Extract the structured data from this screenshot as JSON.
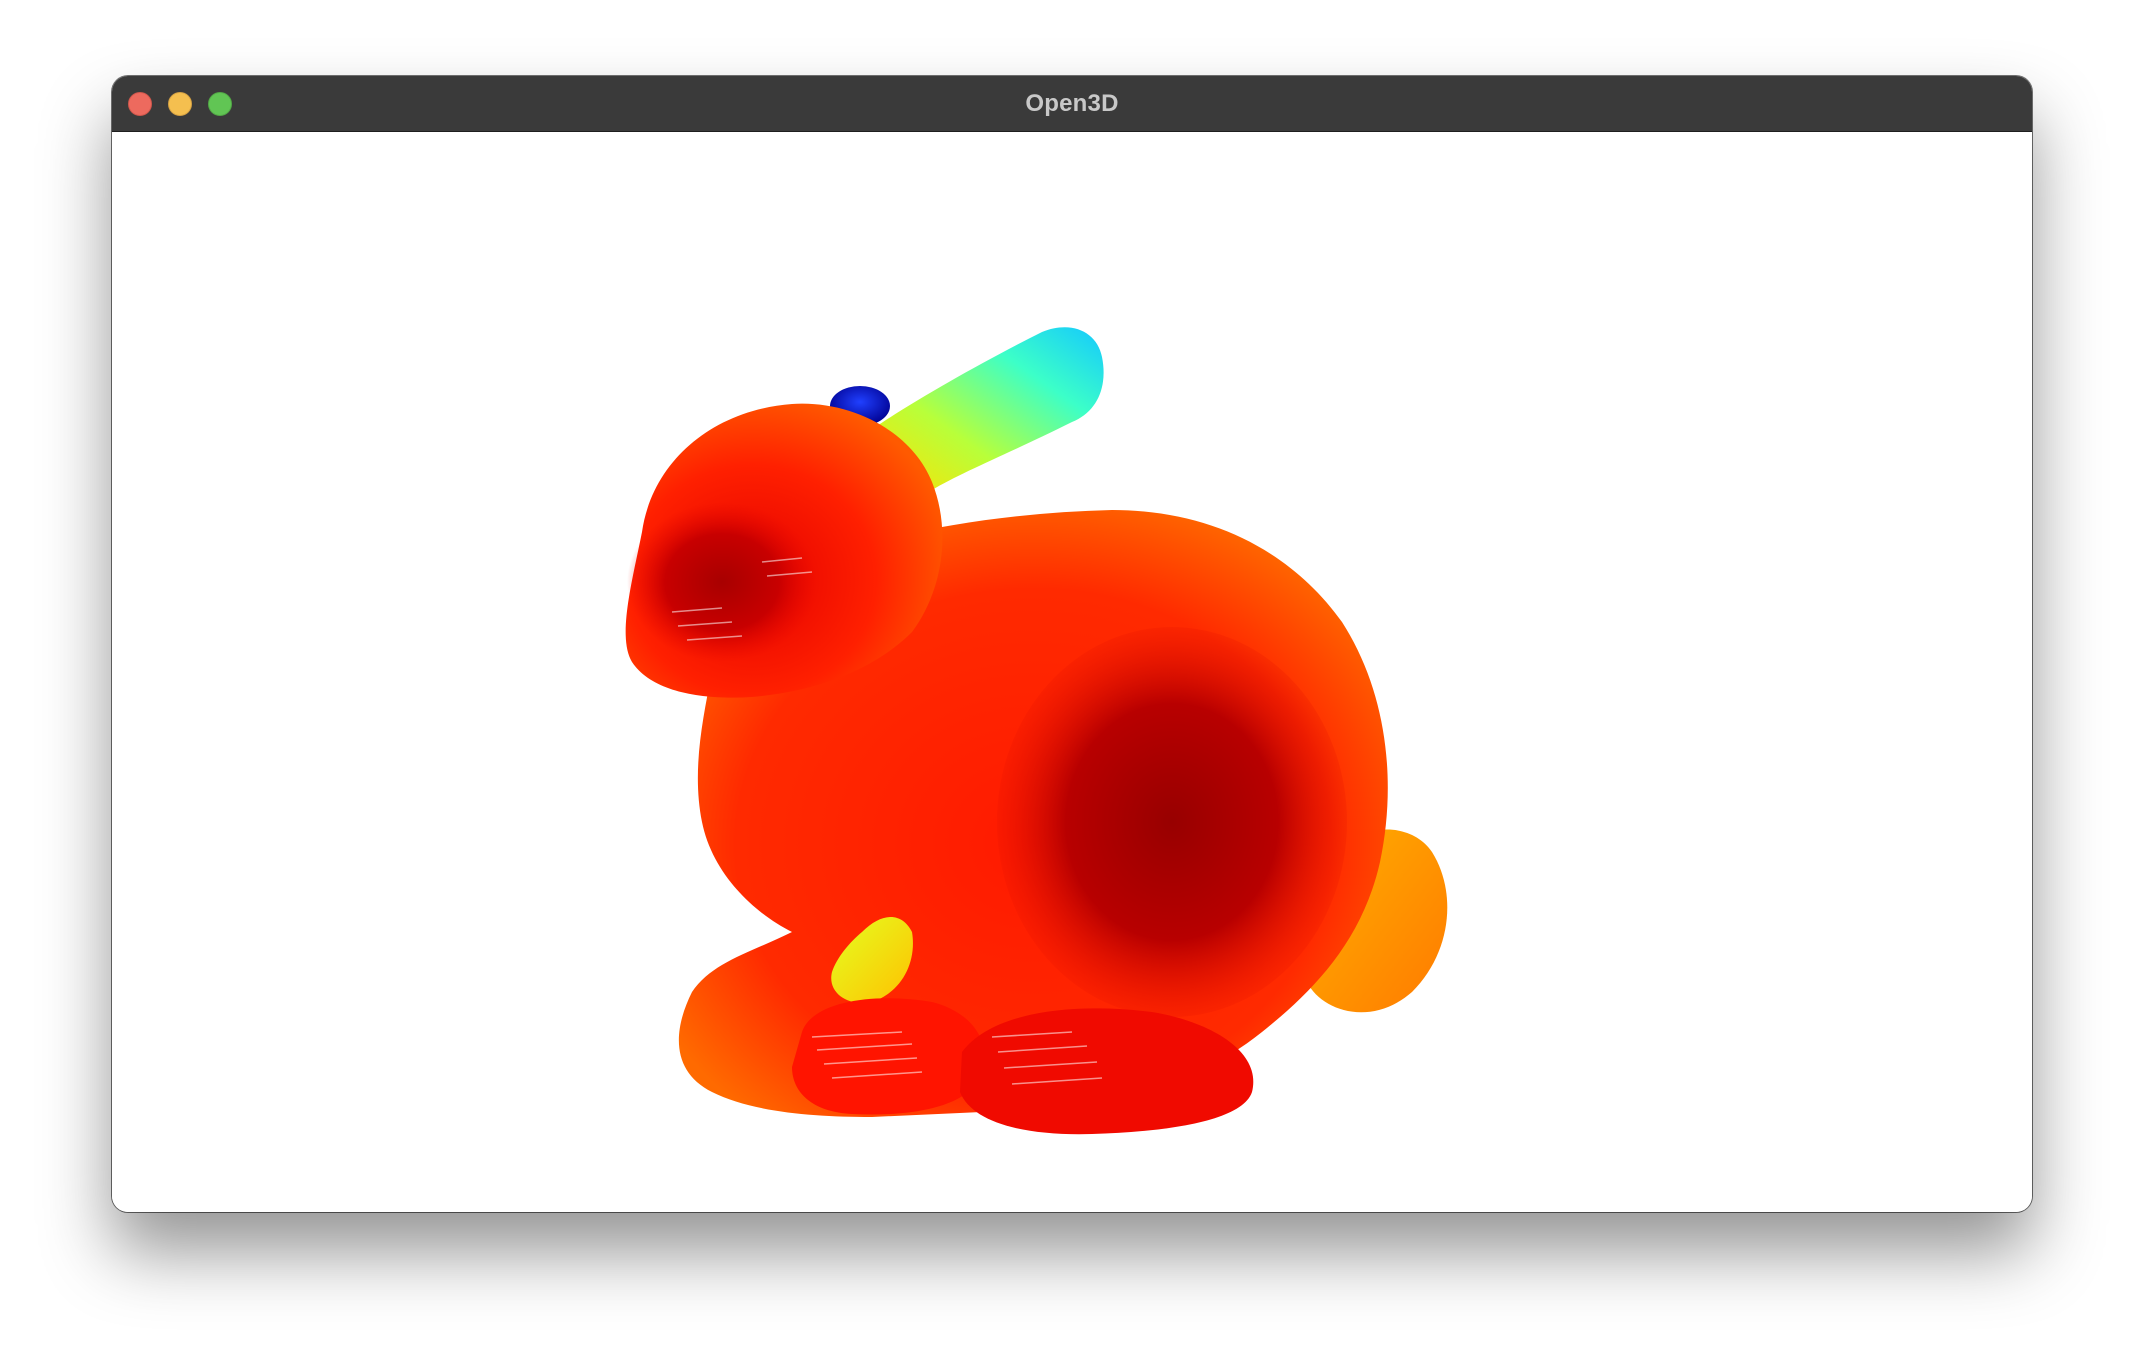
{
  "window": {
    "title": "Open3D",
    "buttons": [
      {
        "name": "close",
        "color": "#ed6a5e"
      },
      {
        "name": "minimize",
        "color": "#f5bf4f"
      },
      {
        "name": "maximize",
        "color": "#61c554"
      }
    ]
  },
  "viewport": {
    "background": "#ffffff",
    "content": "point-cloud",
    "colormap": [
      "#00008b",
      "#0000ff",
      "#00ffff",
      "#ffff00",
      "#ff0000",
      "#8b0000"
    ]
  }
}
